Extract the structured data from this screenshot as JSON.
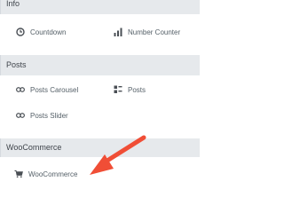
{
  "categories": {
    "info": {
      "title": "Info",
      "widgets": [
        {
          "label": "Countdown",
          "icon": "clock-icon"
        },
        {
          "label": "Number Counter",
          "icon": "bar-chart-icon"
        }
      ]
    },
    "posts": {
      "title": "Posts",
      "widgets": [
        {
          "label": "Posts Carousel",
          "icon": "link-icon"
        },
        {
          "label": "Posts",
          "icon": "grid-list-icon"
        },
        {
          "label": "Posts Slider",
          "icon": "link-icon"
        }
      ]
    },
    "woocommerce": {
      "title": "WooCommerce",
      "widgets": [
        {
          "label": "WooCommerce",
          "icon": "cart-icon"
        }
      ]
    }
  },
  "annotation": {
    "color": "#f04e36",
    "icon": "arrow-icon"
  }
}
